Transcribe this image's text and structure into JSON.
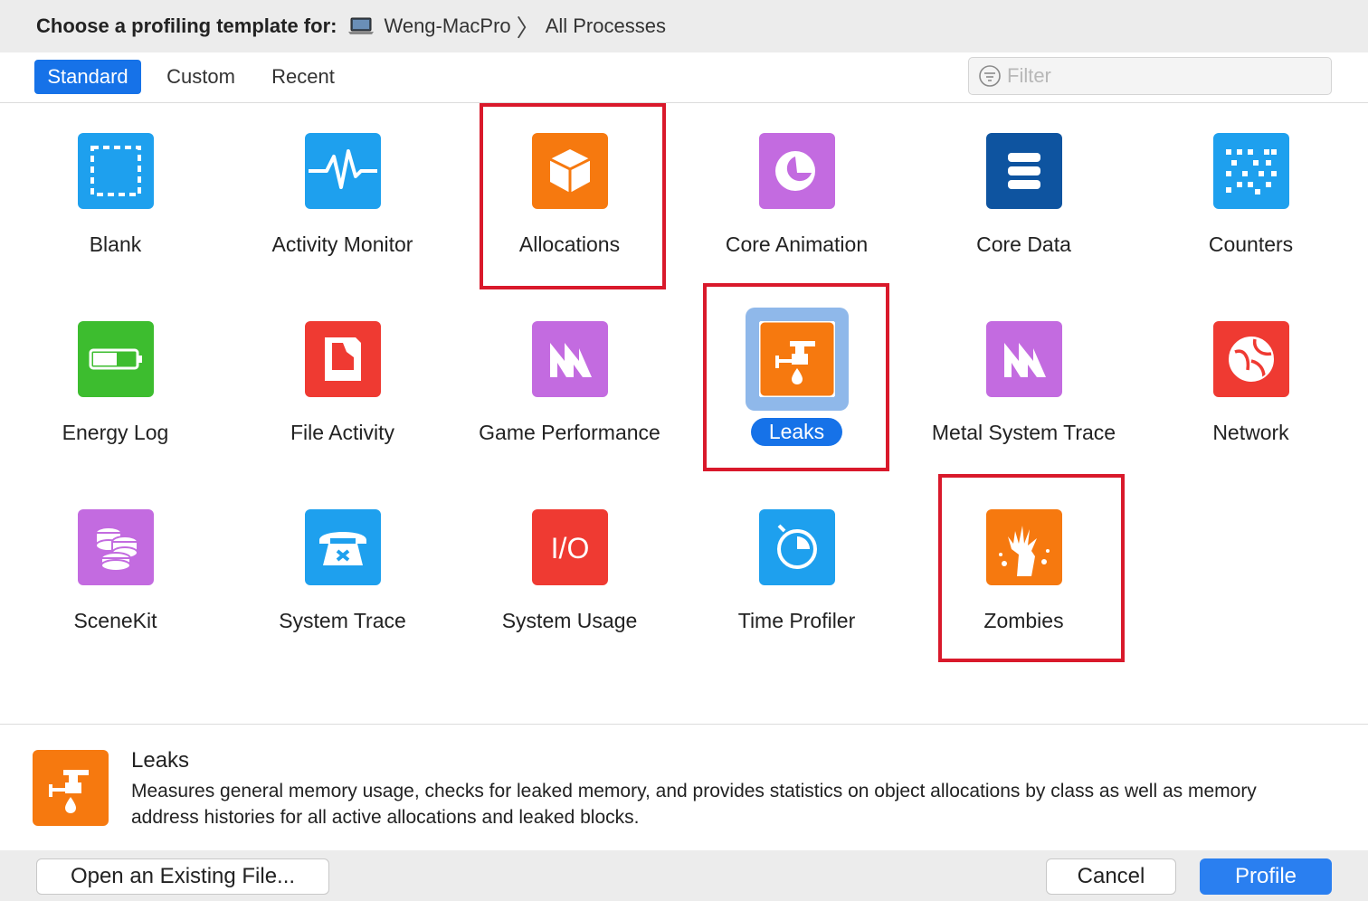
{
  "title_bar": {
    "prompt": "Choose a profiling template for:",
    "device": "Weng-MacPro",
    "target": "All Processes",
    "device_icon": "laptop-icon"
  },
  "tabs": [
    {
      "label": "Standard",
      "active": true
    },
    {
      "label": "Custom",
      "active": false
    },
    {
      "label": "Recent",
      "active": false
    }
  ],
  "filter": {
    "placeholder": "Filter",
    "value": ""
  },
  "templates": [
    {
      "label": "Blank",
      "icon": "blank-icon",
      "color": "#1ea0ee"
    },
    {
      "label": "Activity Monitor",
      "icon": "activity-monitor-icon",
      "color": "#1ea0ee"
    },
    {
      "label": "Allocations",
      "icon": "allocations-icon",
      "color": "#f6790f"
    },
    {
      "label": "Core Animation",
      "icon": "core-animation-icon",
      "color": "#c36be0"
    },
    {
      "label": "Core Data",
      "icon": "core-data-icon",
      "color": "#0e54a0"
    },
    {
      "label": "Counters",
      "icon": "counters-icon",
      "color": "#1ea0ee"
    },
    {
      "label": "Energy Log",
      "icon": "energy-log-icon",
      "color": "#3dbd2f"
    },
    {
      "label": "File Activity",
      "icon": "file-activity-icon",
      "color": "#ef3a32"
    },
    {
      "label": "Game Performance",
      "icon": "game-performance-icon",
      "color": "#c36be0"
    },
    {
      "label": "Leaks",
      "icon": "leaks-icon",
      "color": "#f6790f",
      "selected": true
    },
    {
      "label": "Metal System Trace",
      "icon": "metal-system-trace-icon",
      "color": "#c36be0"
    },
    {
      "label": "Network",
      "icon": "network-icon",
      "color": "#ef3a32"
    },
    {
      "label": "SceneKit",
      "icon": "scenekit-icon",
      "color": "#c36be0"
    },
    {
      "label": "System Trace",
      "icon": "system-trace-icon",
      "color": "#1ea0ee"
    },
    {
      "label": "System Usage",
      "icon": "system-usage-icon",
      "color": "#ef3a32",
      "glyph": "I/O"
    },
    {
      "label": "Time Profiler",
      "icon": "time-profiler-icon",
      "color": "#1ea0ee"
    },
    {
      "label": "Zombies",
      "icon": "zombies-icon",
      "color": "#f6790f"
    }
  ],
  "description": {
    "title": "Leaks",
    "icon": "leaks-icon",
    "body": "Measures general memory usage, checks for leaked memory, and provides statistics on object allocations by class as well as memory address histories for all active allocations and leaked blocks."
  },
  "buttons": {
    "open": "Open an Existing File...",
    "cancel": "Cancel",
    "profile": "Profile"
  },
  "colors": {
    "accent": "#1672e8",
    "highlight_box": "#d9192b",
    "selection_tile": "#8fb8ea"
  }
}
